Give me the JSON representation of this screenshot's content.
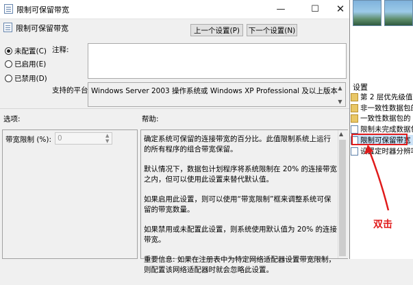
{
  "dialog": {
    "title": "限制可保留带宽",
    "setting_name": "限制可保留带宽",
    "prev_button": "上一个设置(P)",
    "next_button": "下一个设置(N)",
    "min_glyph": "—",
    "max_glyph": "☐",
    "close_glyph": "✕",
    "radios": [
      {
        "label": "未配置(C)",
        "selected": true
      },
      {
        "label": "已启用(E)",
        "selected": false
      },
      {
        "label": "已禁用(D)",
        "selected": false
      }
    ],
    "comment_label": "注释:",
    "comment_value": "",
    "platform_label": "支持的平台:",
    "platform_value": "Windows Server 2003 操作系统或 Windows XP Professional 及以上版本",
    "options_label": "选项:",
    "help_label": "帮助:",
    "bandwidth_label": "带宽限制 (%):",
    "bandwidth_value": "0",
    "help_paragraphs": [
      "确定系统可保留的连接带宽的百分比。此值限制系统上运行的所有程序的组合带宽保留。",
      "默认情况下，数据包计划程序将系统限制在 20% 的连接带宽之内，但可以使用此设置来替代默认值。",
      "如果启用此设置，则可以使用“带宽限制”框来调整系统可保留的带宽数量。",
      "如果禁用或未配置此设置，则系统使用默认值为 20% 的连接带宽。",
      "重要信息: 如果在注册表中为特定网络适配器设置带宽限制，则配置该网络适配器时就会忽略此设置。"
    ]
  },
  "background_window": {
    "section_label": "设置",
    "items": [
      {
        "label": "第 2 层优先级值",
        "icon": "folder-icon"
      },
      {
        "label": "非一致性数据包的",
        "icon": "folder-icon"
      },
      {
        "label": "一致性数据包的 DS",
        "icon": "folder-icon"
      },
      {
        "label": "限制未完成数据包",
        "icon": "policy-icon"
      },
      {
        "label": "限制可保留带宽",
        "icon": "policy-icon"
      },
      {
        "label": "设置定时器分辨率",
        "icon": "policy-icon"
      }
    ]
  },
  "annotation": {
    "label": "双击",
    "color": "#e01b1b"
  }
}
